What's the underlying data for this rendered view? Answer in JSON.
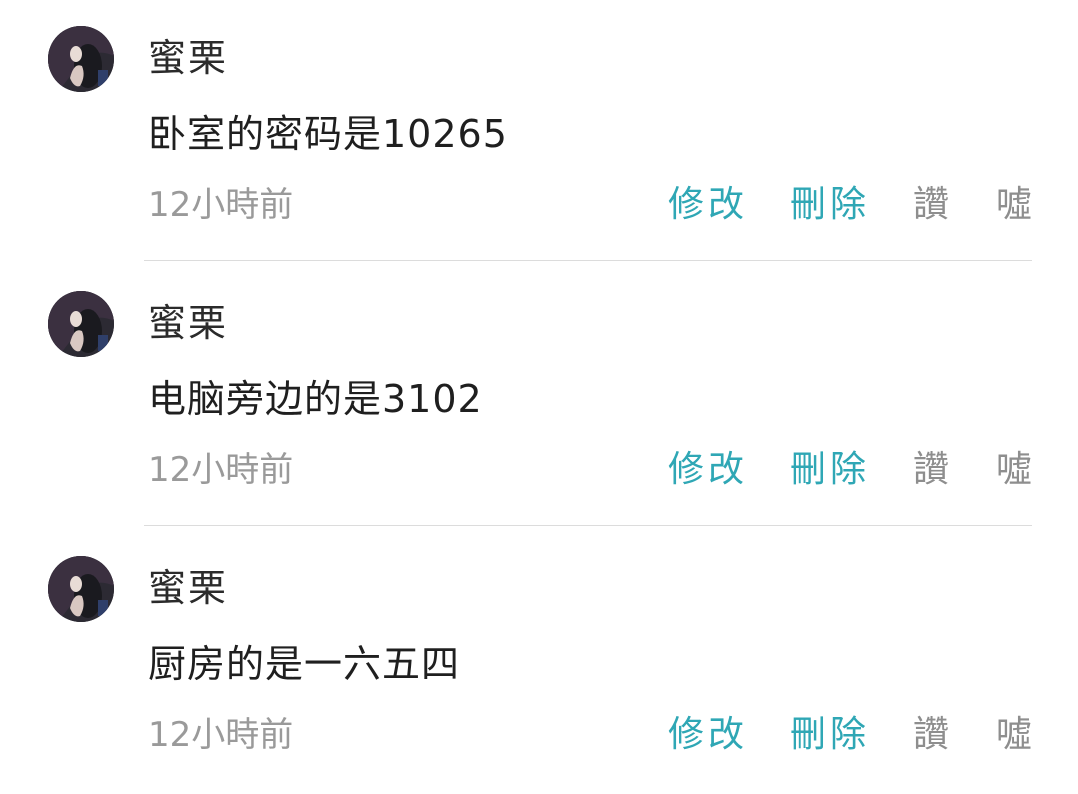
{
  "comments": [
    {
      "author": "蜜栗",
      "text": "卧室的密码是10265",
      "time": "12小時前",
      "actions": {
        "edit": "修改",
        "delete": "刪除",
        "like": "讚",
        "boo": "噓"
      }
    },
    {
      "author": "蜜栗",
      "text": "电脑旁边的是3102",
      "time": "12小時前",
      "actions": {
        "edit": "修改",
        "delete": "刪除",
        "like": "讚",
        "boo": "噓"
      }
    },
    {
      "author": "蜜栗",
      "text": "厨房的是一六五四",
      "time": "12小時前",
      "actions": {
        "edit": "修改",
        "delete": "刪除",
        "like": "讚",
        "boo": "噓"
      }
    }
  ],
  "colors": {
    "action_accent": "#2fa7b5",
    "action_muted": "#8e8e8e",
    "meta_text": "#9a9a9a",
    "divider": "#dcdcdc"
  }
}
